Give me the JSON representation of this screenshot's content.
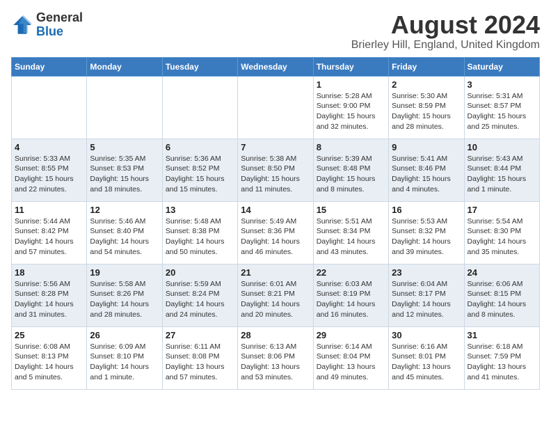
{
  "header": {
    "logo_general": "General",
    "logo_blue": "Blue",
    "main_title": "August 2024",
    "subtitle": "Brierley Hill, England, United Kingdom"
  },
  "calendar": {
    "days_of_week": [
      "Sunday",
      "Monday",
      "Tuesday",
      "Wednesday",
      "Thursday",
      "Friday",
      "Saturday"
    ],
    "weeks": [
      {
        "row_class": "week-row-light",
        "days": [
          {
            "number": "",
            "info": ""
          },
          {
            "number": "",
            "info": ""
          },
          {
            "number": "",
            "info": ""
          },
          {
            "number": "",
            "info": ""
          },
          {
            "number": "1",
            "info": "Sunrise: 5:28 AM\nSunset: 9:00 PM\nDaylight: 15 hours\nand 32 minutes."
          },
          {
            "number": "2",
            "info": "Sunrise: 5:30 AM\nSunset: 8:59 PM\nDaylight: 15 hours\nand 28 minutes."
          },
          {
            "number": "3",
            "info": "Sunrise: 5:31 AM\nSunset: 8:57 PM\nDaylight: 15 hours\nand 25 minutes."
          }
        ]
      },
      {
        "row_class": "week-row-dark",
        "days": [
          {
            "number": "4",
            "info": "Sunrise: 5:33 AM\nSunset: 8:55 PM\nDaylight: 15 hours\nand 22 minutes."
          },
          {
            "number": "5",
            "info": "Sunrise: 5:35 AM\nSunset: 8:53 PM\nDaylight: 15 hours\nand 18 minutes."
          },
          {
            "number": "6",
            "info": "Sunrise: 5:36 AM\nSunset: 8:52 PM\nDaylight: 15 hours\nand 15 minutes."
          },
          {
            "number": "7",
            "info": "Sunrise: 5:38 AM\nSunset: 8:50 PM\nDaylight: 15 hours\nand 11 minutes."
          },
          {
            "number": "8",
            "info": "Sunrise: 5:39 AM\nSunset: 8:48 PM\nDaylight: 15 hours\nand 8 minutes."
          },
          {
            "number": "9",
            "info": "Sunrise: 5:41 AM\nSunset: 8:46 PM\nDaylight: 15 hours\nand 4 minutes."
          },
          {
            "number": "10",
            "info": "Sunrise: 5:43 AM\nSunset: 8:44 PM\nDaylight: 15 hours\nand 1 minute."
          }
        ]
      },
      {
        "row_class": "week-row-light",
        "days": [
          {
            "number": "11",
            "info": "Sunrise: 5:44 AM\nSunset: 8:42 PM\nDaylight: 14 hours\nand 57 minutes."
          },
          {
            "number": "12",
            "info": "Sunrise: 5:46 AM\nSunset: 8:40 PM\nDaylight: 14 hours\nand 54 minutes."
          },
          {
            "number": "13",
            "info": "Sunrise: 5:48 AM\nSunset: 8:38 PM\nDaylight: 14 hours\nand 50 minutes."
          },
          {
            "number": "14",
            "info": "Sunrise: 5:49 AM\nSunset: 8:36 PM\nDaylight: 14 hours\nand 46 minutes."
          },
          {
            "number": "15",
            "info": "Sunrise: 5:51 AM\nSunset: 8:34 PM\nDaylight: 14 hours\nand 43 minutes."
          },
          {
            "number": "16",
            "info": "Sunrise: 5:53 AM\nSunset: 8:32 PM\nDaylight: 14 hours\nand 39 minutes."
          },
          {
            "number": "17",
            "info": "Sunrise: 5:54 AM\nSunset: 8:30 PM\nDaylight: 14 hours\nand 35 minutes."
          }
        ]
      },
      {
        "row_class": "week-row-dark",
        "days": [
          {
            "number": "18",
            "info": "Sunrise: 5:56 AM\nSunset: 8:28 PM\nDaylight: 14 hours\nand 31 minutes."
          },
          {
            "number": "19",
            "info": "Sunrise: 5:58 AM\nSunset: 8:26 PM\nDaylight: 14 hours\nand 28 minutes."
          },
          {
            "number": "20",
            "info": "Sunrise: 5:59 AM\nSunset: 8:24 PM\nDaylight: 14 hours\nand 24 minutes."
          },
          {
            "number": "21",
            "info": "Sunrise: 6:01 AM\nSunset: 8:21 PM\nDaylight: 14 hours\nand 20 minutes."
          },
          {
            "number": "22",
            "info": "Sunrise: 6:03 AM\nSunset: 8:19 PM\nDaylight: 14 hours\nand 16 minutes."
          },
          {
            "number": "23",
            "info": "Sunrise: 6:04 AM\nSunset: 8:17 PM\nDaylight: 14 hours\nand 12 minutes."
          },
          {
            "number": "24",
            "info": "Sunrise: 6:06 AM\nSunset: 8:15 PM\nDaylight: 14 hours\nand 8 minutes."
          }
        ]
      },
      {
        "row_class": "week-row-light",
        "days": [
          {
            "number": "25",
            "info": "Sunrise: 6:08 AM\nSunset: 8:13 PM\nDaylight: 14 hours\nand 5 minutes."
          },
          {
            "number": "26",
            "info": "Sunrise: 6:09 AM\nSunset: 8:10 PM\nDaylight: 14 hours\nand 1 minute."
          },
          {
            "number": "27",
            "info": "Sunrise: 6:11 AM\nSunset: 8:08 PM\nDaylight: 13 hours\nand 57 minutes."
          },
          {
            "number": "28",
            "info": "Sunrise: 6:13 AM\nSunset: 8:06 PM\nDaylight: 13 hours\nand 53 minutes."
          },
          {
            "number": "29",
            "info": "Sunrise: 6:14 AM\nSunset: 8:04 PM\nDaylight: 13 hours\nand 49 minutes."
          },
          {
            "number": "30",
            "info": "Sunrise: 6:16 AM\nSunset: 8:01 PM\nDaylight: 13 hours\nand 45 minutes."
          },
          {
            "number": "31",
            "info": "Sunrise: 6:18 AM\nSunset: 7:59 PM\nDaylight: 13 hours\nand 41 minutes."
          }
        ]
      }
    ]
  }
}
